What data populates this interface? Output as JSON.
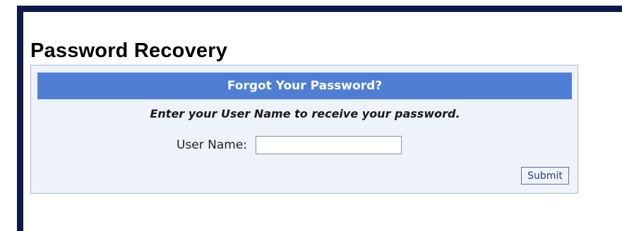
{
  "page": {
    "title": "Password Recovery"
  },
  "panel": {
    "header": "Forgot Your Password?",
    "instructions": "Enter your User Name to receive your password.",
    "username": {
      "label": "User Name:",
      "value": "",
      "placeholder": ""
    },
    "submit_label": "Submit"
  },
  "colors": {
    "frame_border": "#0d1a4a",
    "header_background": "#4f7fd4",
    "panel_background": "#eef2fa",
    "panel_border": "#a9b9d6"
  }
}
